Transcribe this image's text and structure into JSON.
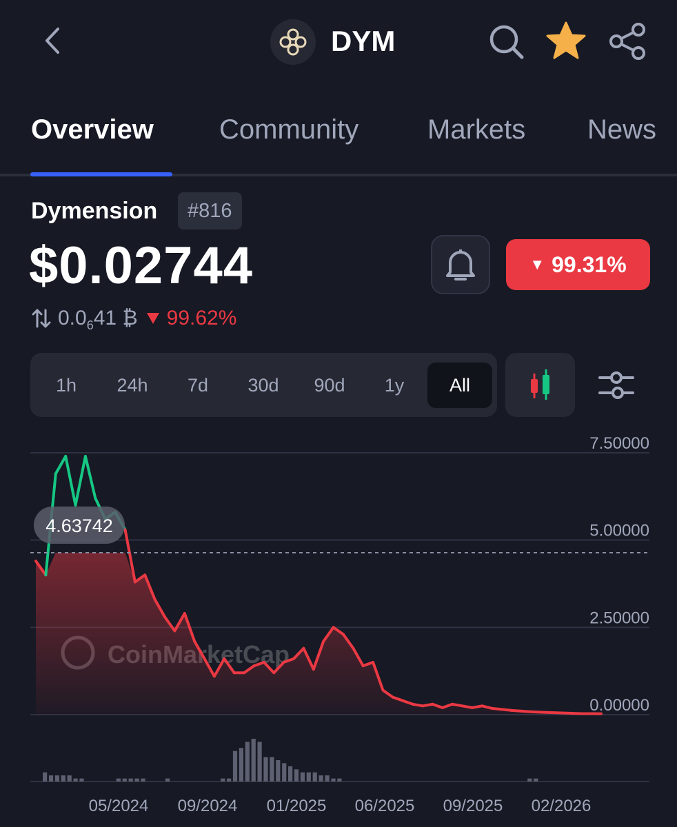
{
  "header": {
    "symbol": "DYM",
    "icons": [
      "back-icon",
      "dymension-logo-icon",
      "search-icon",
      "star-icon",
      "share-icon"
    ],
    "star_color": "#f5b04a"
  },
  "tabs": [
    {
      "label": "Overview",
      "active": true
    },
    {
      "label": "Community",
      "active": false
    },
    {
      "label": "Markets",
      "active": false
    },
    {
      "label": "News",
      "active": false
    }
  ],
  "coin": {
    "name": "Dymension",
    "rank": "#816",
    "price": "$0.02744",
    "btc_prefix": "0.0",
    "btc_subscript": "6",
    "btc_suffix": "41 ₿",
    "btc_change": "99.62%",
    "price_change": "99.31%",
    "change_color": "#ea3943"
  },
  "ranges": [
    {
      "label": "1h",
      "active": false
    },
    {
      "label": "24h",
      "active": false
    },
    {
      "label": "7d",
      "active": false
    },
    {
      "label": "30d",
      "active": false
    },
    {
      "label": "90d",
      "active": false
    },
    {
      "label": "1y",
      "active": false
    },
    {
      "label": "All",
      "active": true
    }
  ],
  "chart_data": {
    "type": "line",
    "y_ticks": [
      "7.50000",
      "5.00000",
      "2.50000",
      "0.00000"
    ],
    "ylim": [
      0,
      7.5
    ],
    "x_tick_labels": [
      "05/2024",
      "09/2024",
      "01/2025",
      "06/2025",
      "09/2025",
      "02/2026"
    ],
    "reference_label": "4.63742",
    "reference_value": 4.63742,
    "watermark": "CoinMarketCap",
    "up_color": "#16c784",
    "down_color": "#ea3943",
    "series": [
      {
        "values": [
          4.4,
          4.0,
          6.9,
          7.4,
          6.0,
          7.4,
          6.2,
          5.6,
          5.8,
          5.3,
          3.8,
          4.0,
          3.3,
          2.8,
          2.4,
          2.9,
          2.1,
          1.6,
          1.1,
          1.6,
          1.2,
          1.2,
          1.4,
          1.5,
          1.2,
          1.5,
          1.6,
          1.9,
          1.3,
          2.1,
          2.5,
          2.3,
          1.9,
          1.4,
          1.5,
          0.7,
          0.5,
          0.4,
          0.3,
          0.25,
          0.3,
          0.2,
          0.3,
          0.25,
          0.2,
          0.25,
          0.18,
          0.15,
          0.12,
          0.1,
          0.08,
          0.07,
          0.06,
          0.05,
          0.04,
          0.03,
          0.03,
          0.027
        ]
      }
    ],
    "volume": [
      1,
      1,
      1,
      1,
      1,
      1,
      1,
      0,
      0,
      0,
      0,
      0,
      0,
      0,
      0,
      1,
      1,
      1,
      1,
      1,
      1,
      1,
      0,
      0,
      0,
      0,
      0,
      0,
      0,
      0,
      1,
      1,
      1,
      1,
      1,
      2,
      2,
      2,
      3,
      3,
      2,
      2,
      2,
      2,
      2,
      1,
      1,
      1,
      1,
      1,
      0,
      0,
      0,
      0,
      0,
      0,
      0,
      0,
      0,
      0,
      0,
      0,
      0,
      0,
      0,
      0,
      0,
      0,
      0,
      0,
      0,
      0,
      0,
      0,
      0,
      0,
      0,
      0,
      0,
      0,
      0,
      0,
      1,
      1,
      0,
      0,
      0,
      0,
      0,
      0,
      0,
      0,
      0,
      0
    ],
    "volume_bars": [
      3,
      2,
      2,
      2,
      2,
      1,
      1,
      0,
      0,
      0,
      0,
      0,
      1,
      1,
      1,
      1,
      1,
      0,
      0,
      0,
      1,
      0,
      0,
      0,
      0,
      0,
      0,
      0,
      0,
      1,
      1,
      10,
      11,
      13,
      14,
      13,
      8,
      8,
      7,
      6,
      5,
      4,
      3,
      3,
      3,
      2,
      2,
      1,
      1,
      0,
      0,
      0,
      0,
      0,
      0,
      0,
      0,
      0,
      0,
      0,
      0,
      0,
      0,
      0,
      0,
      0,
      0,
      0,
      0,
      0,
      0,
      0,
      0,
      0,
      0,
      0,
      0,
      0,
      0,
      1,
      1,
      0,
      0,
      0,
      0,
      0,
      0,
      0,
      0,
      0,
      0
    ]
  }
}
